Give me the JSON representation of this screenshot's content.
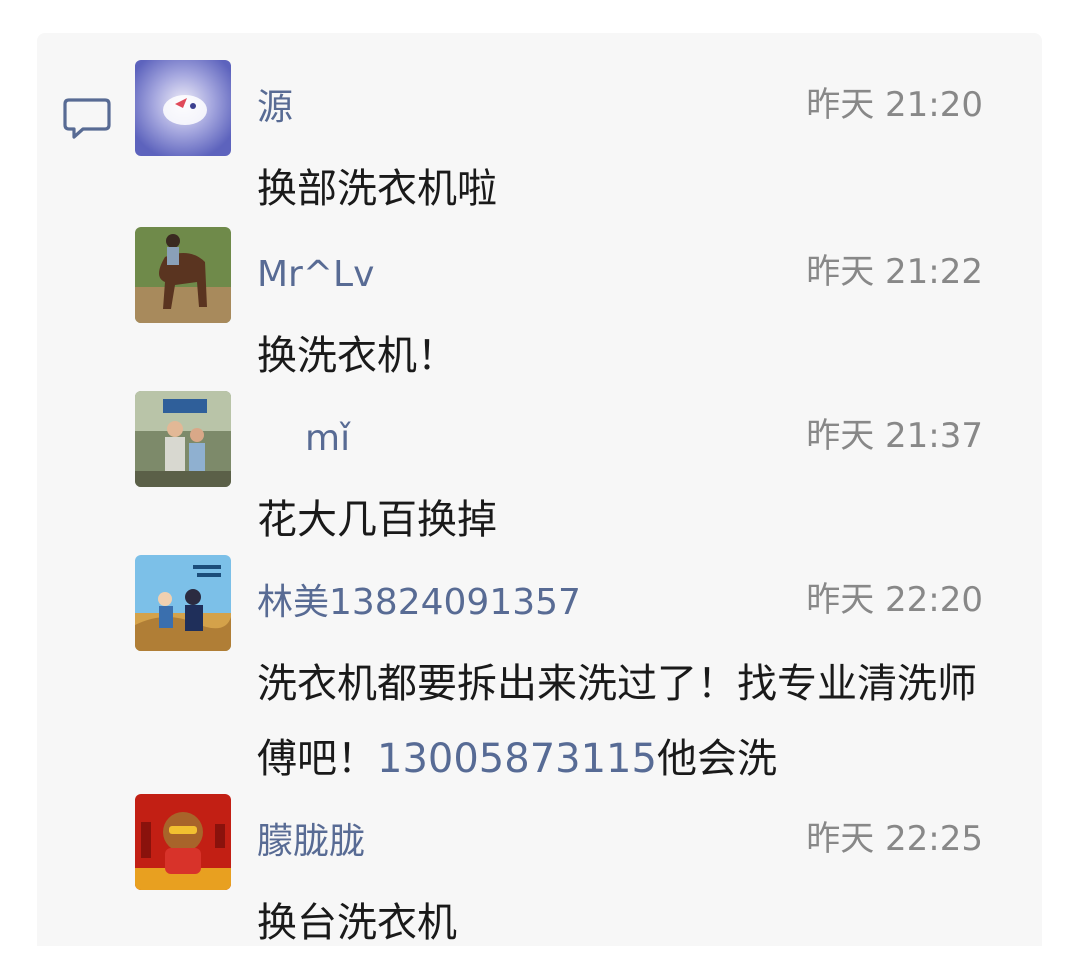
{
  "comments": [
    {
      "name": "源",
      "time": "昨天 21:20",
      "text": "换部洗衣机啦",
      "avatar": "avatar-blurred-cat"
    },
    {
      "name": "Mr^Lv",
      "time": "昨天 21:22",
      "text": "换洗衣机！",
      "avatar": "avatar-horse-rider"
    },
    {
      "name": "mǐ",
      "time": "昨天 21:37",
      "text": "花大几百换掉",
      "avatar": "avatar-family-photo"
    },
    {
      "name": "林美13824091357",
      "time": "昨天 22:20",
      "text_before": "洗衣机都要拆出来洗过了！找专业清洗师傅吧！",
      "phone": "13005873115",
      "text_after": "他会洗",
      "avatar": "avatar-illustration-couple"
    },
    {
      "name": "朦胧胧",
      "time": "昨天 22:25",
      "text": "换台洗衣机",
      "avatar": "avatar-red-cartoon"
    }
  ],
  "icons": {
    "comment": "comment-bubble-icon"
  },
  "colors": {
    "name": "#586b94",
    "time": "#888888",
    "text": "#1a1a1a",
    "link": "#576b95",
    "panel": "#f7f7f7"
  }
}
